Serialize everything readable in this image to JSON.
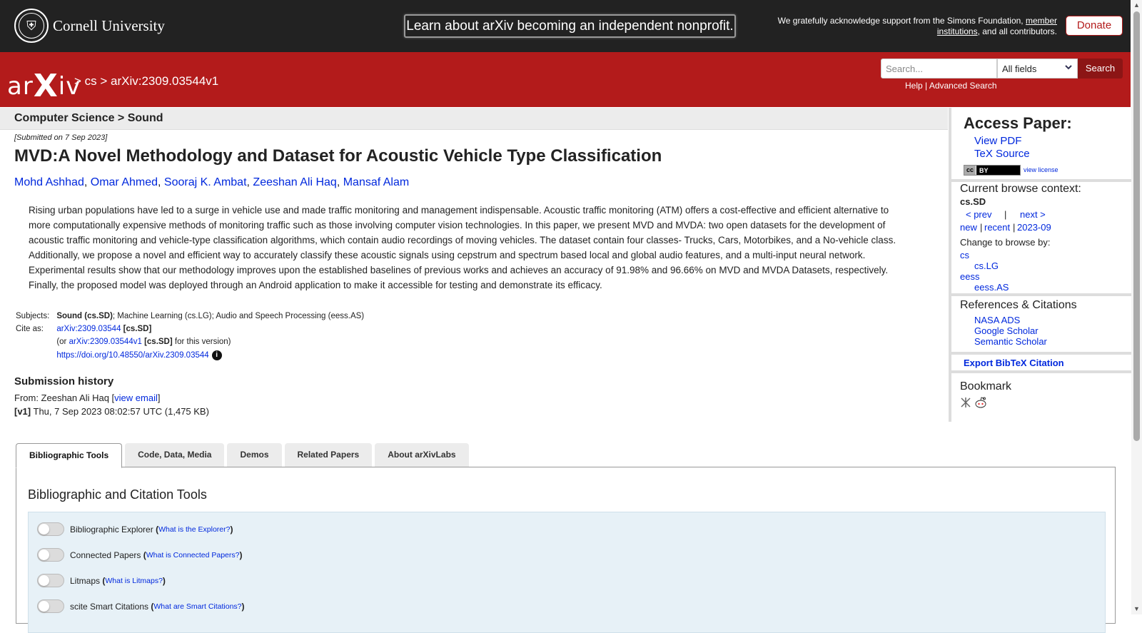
{
  "topbar": {
    "cornell": "Cornell University",
    "nonprofit": "Learn about arXiv becoming an independent nonprofit.",
    "support_pre": "We gratefully acknowledge support from the Simons Foundation,",
    "support_link1": "member",
    "support_link2": "institutions",
    "support_post": ", and all contributors.",
    "donate": "Donate"
  },
  "header": {
    "logo": "arXiv",
    "breadcrumb": "> cs > arXiv:2309.03544v1",
    "search_placeholder": "Search...",
    "field_select": "All fields",
    "search_button": "Search",
    "help": "Help",
    "sep": " | ",
    "advanced": "Advanced Search"
  },
  "main": {
    "subheader": "Computer Science > Sound",
    "submitted": "[Submitted on 7 Sep 2023]",
    "title": "MVD:A Novel Methodology and Dataset for Acoustic Vehicle Type Classification",
    "authors": [
      "Mohd Ashhad",
      "Omar Ahmed",
      "Sooraj K. Ambat",
      "Zeeshan Ali Haq",
      "Mansaf Alam"
    ],
    "author_sep": ", ",
    "abstract": "Rising urban populations have led to a surge in vehicle use and made traffic monitoring and management indispensable. Acoustic traffic monitoring (ATM) offers a cost-effective and efficient alternative to more computationally expensive methods of monitoring traffic such as those involving computer vision technologies. In this paper, we present MVD and MVDA: two open datasets for the development of acoustic traffic monitoring and vehicle-type classification algorithms, which contain audio recordings of moving vehicles. The dataset contain four classes- Trucks, Cars, Motorbikes, and a No-vehicle class. Additionally, we propose a novel and efficient way to accurately classify these acoustic signals using cepstrum and spectrum based local and global audio features, and a multi-input neural network. Experimental results show that our methodology improves upon the established baselines of previous works and achieves an accuracy of 91.98% and 96.66% on MVD and MVDA Datasets, respectively. Finally, the proposed model was deployed through an Android application to make it accessible for testing and demonstrate its efficacy.",
    "meta": {
      "subjects_label": "Subjects:",
      "subjects_primary": "Sound (cs.SD)",
      "subjects_rest": "; Machine Learning (cs.LG); Audio and Speech Processing (eess.AS)",
      "cite_label": "Cite as:",
      "cite_id": "arXiv:2309.03544",
      "cite_cat": " [cs.SD]",
      "or_pre": "(or ",
      "cite_version": "arXiv:2309.03544v1",
      "or_cat": " [cs.SD]",
      "or_post": " for this version)",
      "doi": "https://doi.org/10.48550/arXiv.2309.03544",
      "info": "i"
    },
    "history": {
      "title": "Submission history",
      "from_pre": "From: Zeeshan Ali Haq [",
      "from_link": "view email",
      "from_post": "]",
      "v1_label": "[v1]",
      "v1_text": " Thu, 7 Sep 2023 08:02:57 UTC (1,475 KB)"
    }
  },
  "tabs": [
    "Bibliographic Tools",
    "Code, Data, Media",
    "Demos",
    "Related Papers",
    "About arXivLabs"
  ],
  "panel": {
    "title": "Bibliographic and Citation Tools",
    "tools": [
      {
        "name": "Bibliographic Explorer",
        "help": "What is the Explorer?"
      },
      {
        "name": "Connected Papers",
        "help": "What is Connected Papers?"
      },
      {
        "name": "Litmaps",
        "help": "What is Litmaps?"
      },
      {
        "name": "scite Smart Citations",
        "help": "What are Smart Citations?"
      }
    ]
  },
  "sidebar": {
    "access_title": "Access Paper:",
    "view_pdf": "View PDF",
    "tex_source": "TeX Source",
    "license_cc": "cc",
    "license_by": "BY",
    "view_license": "view license",
    "context_title": "Current browse context:",
    "context": "cs.SD",
    "prev": "< prev",
    "pipe": "|",
    "next": "next >",
    "new": "new",
    "recent": "recent",
    "month": "2023-09",
    "change_browse": "Change to browse by:",
    "browse": [
      "cs",
      "cs.LG",
      "eess",
      "eess.AS"
    ],
    "refs_title": "References & Citations",
    "refs": [
      "NASA ADS",
      "Google Scholar",
      "Semantic Scholar"
    ],
    "export": "Export BibTeX Citation",
    "bookmark": "Bookmark"
  },
  "icons": {
    "cornell_seal": "cornell-seal-icon",
    "info": "info-icon",
    "bibsonomy": "bibsonomy-icon",
    "reddit": "reddit-icon",
    "chevron": "chevron-down-icon"
  },
  "colors": {
    "brand_red": "#b31b1b",
    "topbar": "#222222",
    "link": "#0028dd"
  }
}
